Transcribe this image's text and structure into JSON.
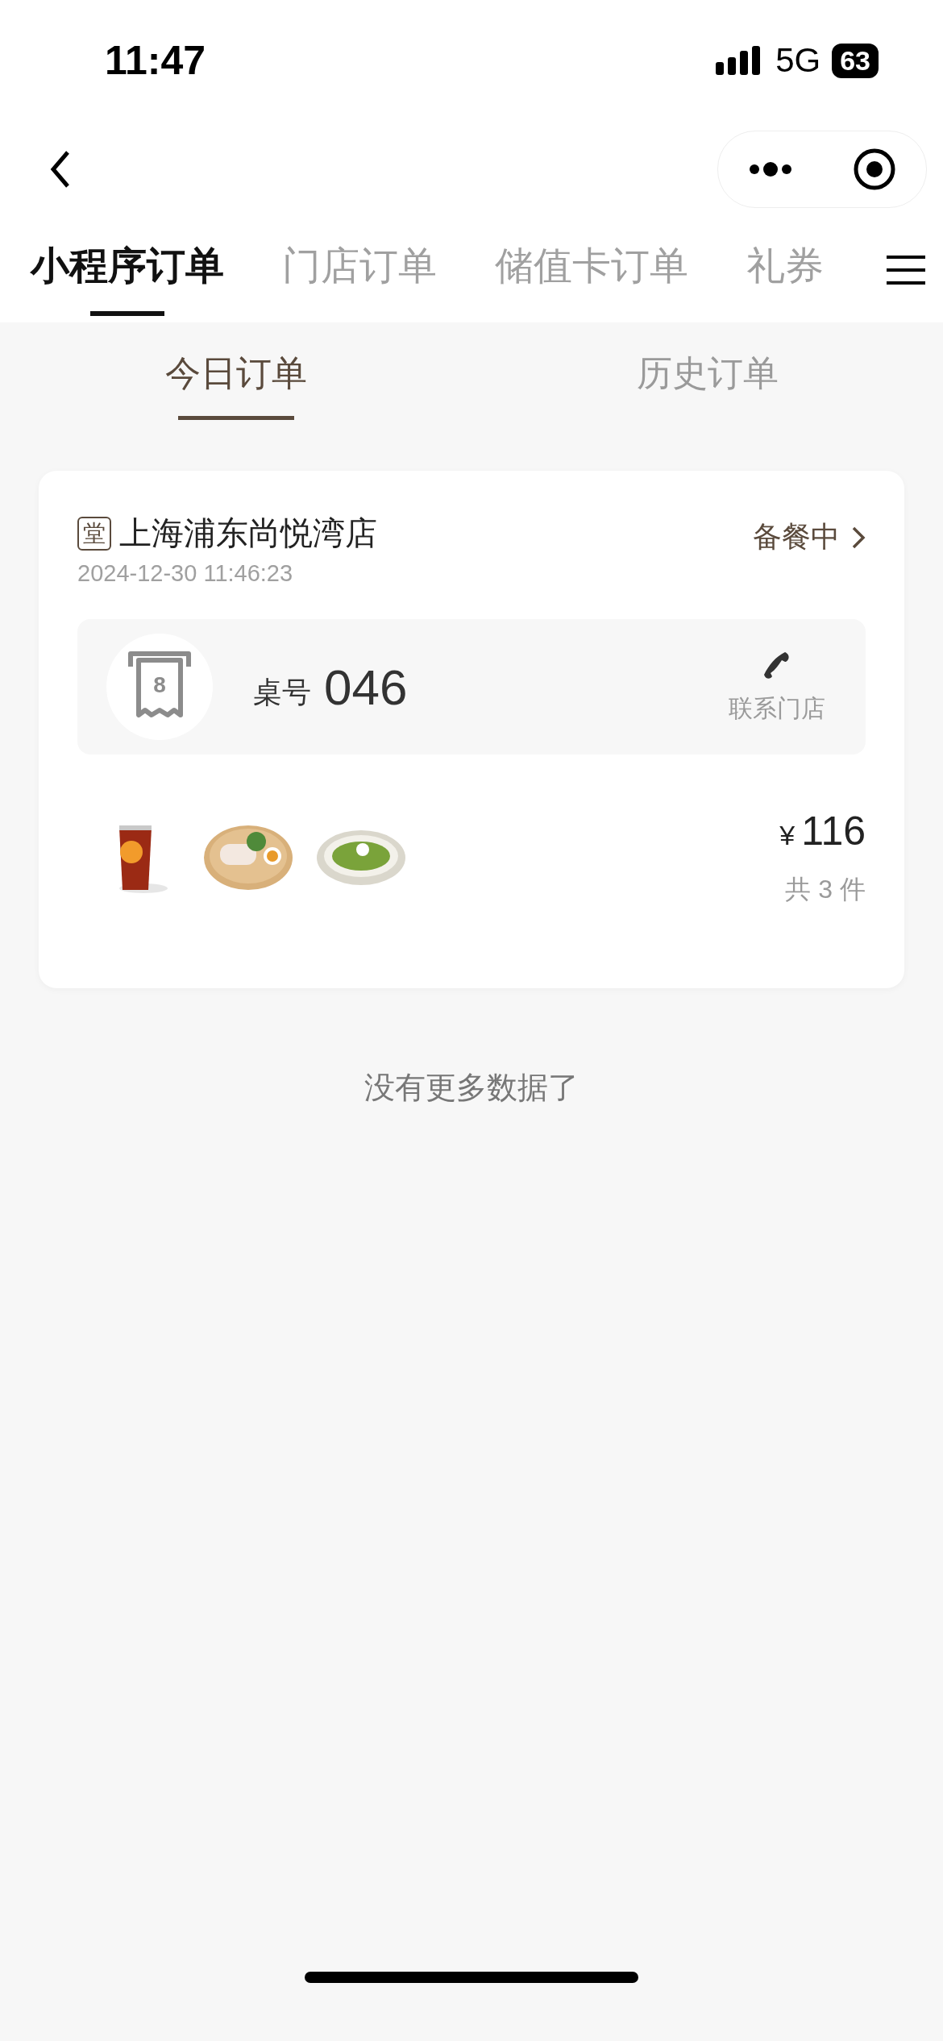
{
  "status_bar": {
    "time": "11:47",
    "network": "5G",
    "battery": "63"
  },
  "tabs": [
    {
      "label": "小程序订单",
      "selected": true
    },
    {
      "label": "门店订单",
      "selected": false
    },
    {
      "label": "储值卡订单",
      "selected": false
    },
    {
      "label": "礼券",
      "selected": false
    }
  ],
  "sub_tabs": [
    {
      "label": "今日订单",
      "selected": true
    },
    {
      "label": "历史订单",
      "selected": false
    }
  ],
  "orders": [
    {
      "badge": "堂",
      "store": "上海浦东尚悦湾店",
      "time": "2024-12-30 11:46:23",
      "status": "备餐中",
      "table_icon_label": "8",
      "table_label": "桌号",
      "table_number": "046",
      "contact": "联系门店",
      "items": [
        {
          "kind": "drink"
        },
        {
          "kind": "plate"
        },
        {
          "kind": "pasta"
        }
      ],
      "price_symbol": "¥",
      "price": "116",
      "count": "共 3 件"
    }
  ],
  "footer": "没有更多数据了"
}
